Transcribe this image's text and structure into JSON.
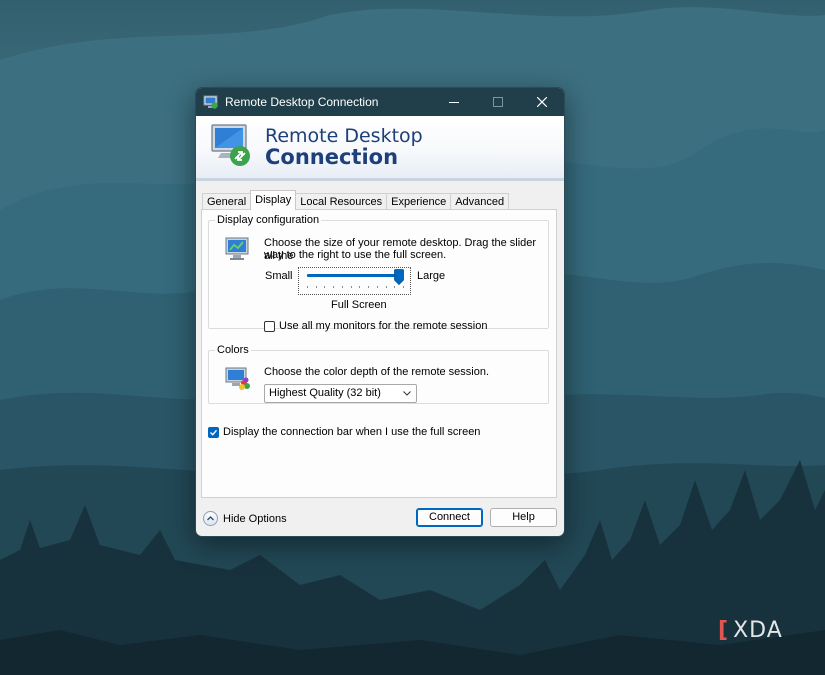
{
  "window": {
    "title": "Remote Desktop Connection",
    "controls": {
      "minimize": "minimize-icon",
      "maximize": "maximize-icon",
      "close": "close-icon"
    }
  },
  "banner": {
    "line1": "Remote Desktop",
    "line2": "Connection"
  },
  "tabs": [
    {
      "label": "General",
      "active": false
    },
    {
      "label": "Display",
      "active": true
    },
    {
      "label": "Local Resources",
      "active": false
    },
    {
      "label": "Experience",
      "active": false
    },
    {
      "label": "Advanced",
      "active": false
    }
  ],
  "display_config": {
    "legend": "Display configuration",
    "description_line1": "Choose the size of your remote desktop. Drag the slider all the",
    "description_line2": "way to the right to use the full screen.",
    "slider": {
      "min_label": "Small",
      "max_label": "Large",
      "value_label": "Full Screen",
      "position": 1.0
    },
    "monitors_checkbox": {
      "label": "Use all my monitors for the remote session",
      "checked": false
    }
  },
  "colors": {
    "legend": "Colors",
    "description": "Choose the color depth of the remote session.",
    "selected": "Highest Quality (32 bit)"
  },
  "connection_bar_checkbox": {
    "label": "Display the connection bar when I use the full screen",
    "checked": true
  },
  "footer": {
    "hide_options": "Hide Options",
    "connect": "Connect",
    "help": "Help"
  },
  "watermark": {
    "text": "XDA"
  },
  "theme": {
    "accent": "#0067c0",
    "titlebar": "#203f4a",
    "banner_text": "#1d3f7a"
  }
}
